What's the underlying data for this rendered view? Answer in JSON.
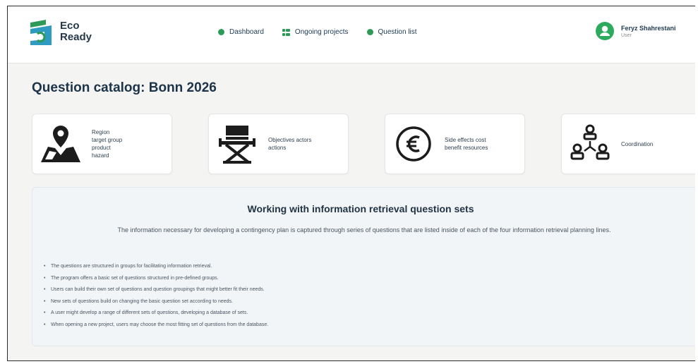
{
  "app": {
    "logo_line1": "Eco",
    "logo_line2": "Ready",
    "colors": {
      "brand_green": "#2e9a57",
      "brand_navy": "#24384a",
      "avatar_green": "#2eaa5e"
    }
  },
  "nav": {
    "items": [
      {
        "label": "Dashboard",
        "icon": "dot-icon"
      },
      {
        "label": "Ongoing projects",
        "icon": "grid-icon"
      },
      {
        "label": "Question list",
        "icon": "dot-icon"
      }
    ]
  },
  "user": {
    "name": "Feryz Shahrestani",
    "role": "User",
    "icon": "user-avatar-icon"
  },
  "page": {
    "title": "Question catalog: Bonn 2026"
  },
  "categories": [
    {
      "icon": "location-map-icon",
      "lines": [
        "Region",
        "target group",
        "product",
        "hazard"
      ]
    },
    {
      "icon": "directors-chair-icon",
      "lines": [
        "Objectives actors",
        "actions"
      ]
    },
    {
      "icon": "euro-coin-icon",
      "lines": [
        "Side effects cost",
        "benefit resources"
      ]
    },
    {
      "icon": "people-network-icon",
      "lines": [
        "Coordination"
      ]
    }
  ],
  "info": {
    "title": "Working with information retrieval question sets",
    "intro": "The information necessary for developing a contingency plan is captured through series of questions that are listed inside of each of the four information retrieval planning lines.",
    "bullets": [
      "The questions are structured in groups for facilitating information retrieval.",
      "The program offers a basic set of questions structured in pre-defined groups.",
      "Users can build their own set of questions and question groupings that might better fit their needs.",
      "New sets of questions build on changing the basic question set according to needs.",
      "A user might develop a range of different sets of questions, developing a database of sets.",
      "When opening a new project, users may choose the most fitting set of questions from the database."
    ]
  }
}
